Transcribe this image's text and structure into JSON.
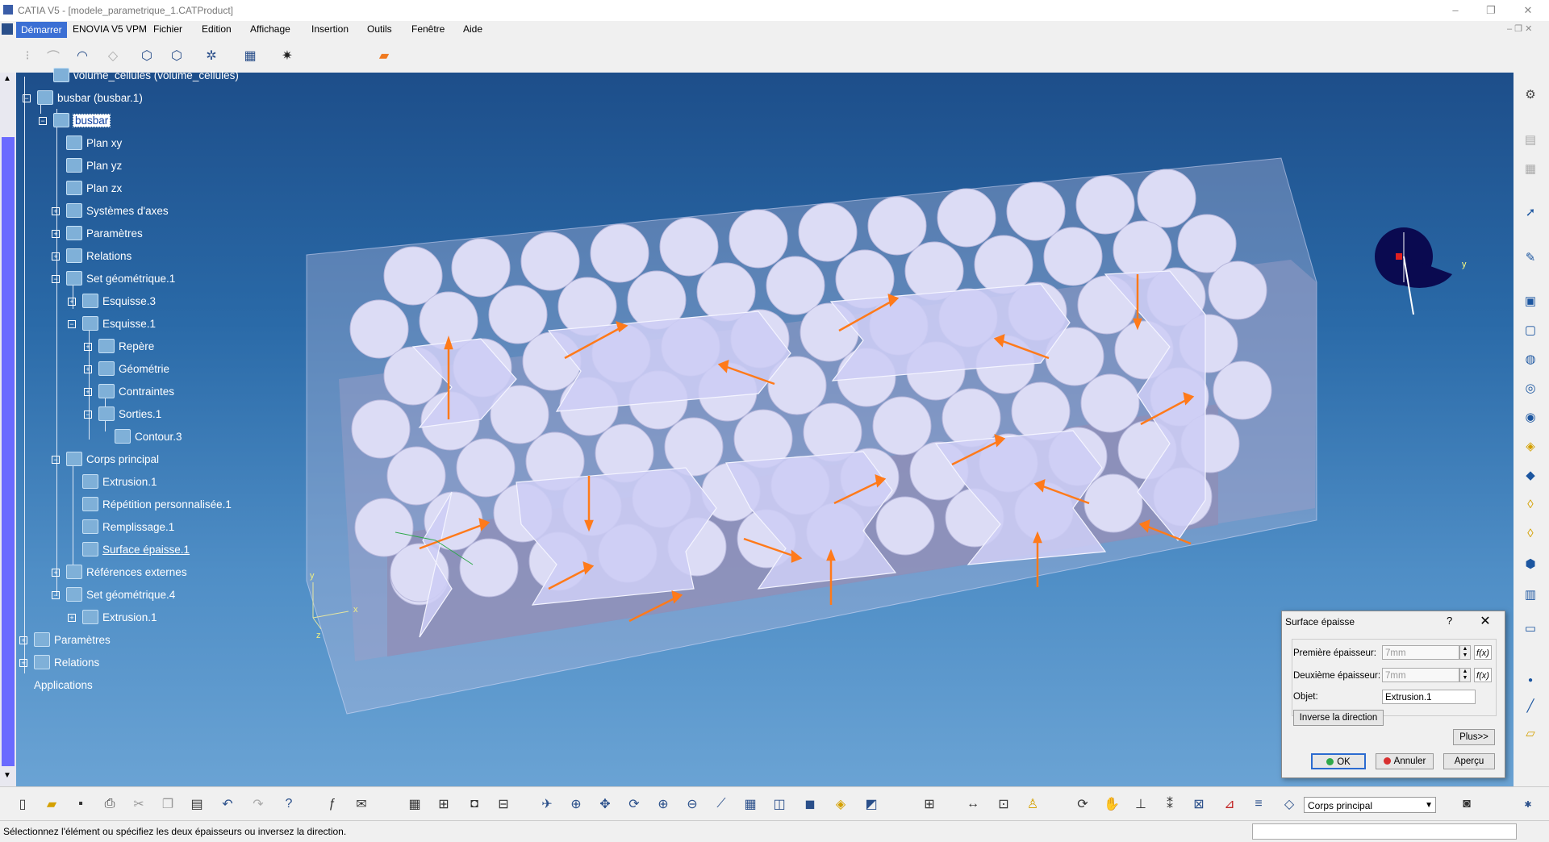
{
  "window": {
    "title": "CATIA V5 - [modele_parametrique_1.CATProduct]",
    "controls": [
      "–",
      "❐",
      "✕"
    ]
  },
  "menubar": {
    "start": "Démarrer",
    "items": [
      "ENOVIA V5 VPM",
      "Fichier",
      "Edition",
      "Affichage",
      "Insertion",
      "Outils",
      "Fenêtre",
      "Aide"
    ]
  },
  "tree": {
    "nodes": [
      {
        "label": "volume_cellules (volume_cellules)"
      },
      {
        "label": "busbar (busbar.1)"
      },
      {
        "label": "busbar",
        "selected": true
      },
      {
        "label": "Plan xy"
      },
      {
        "label": "Plan yz"
      },
      {
        "label": "Plan zx"
      },
      {
        "label": "Systèmes d'axes"
      },
      {
        "label": "Paramètres"
      },
      {
        "label": "Relations"
      },
      {
        "label": "Set géométrique.1"
      },
      {
        "label": "Esquisse.3"
      },
      {
        "label": "Esquisse.1"
      },
      {
        "label": "Repère"
      },
      {
        "label": "Géométrie"
      },
      {
        "label": "Contraintes"
      },
      {
        "label": "Sorties.1"
      },
      {
        "label": "Contour.3"
      },
      {
        "label": "Corps principal"
      },
      {
        "label": "Extrusion.1"
      },
      {
        "label": "Répétition personnalisée.1"
      },
      {
        "label": "Remplissage.1"
      },
      {
        "label": "Surface épaisse.1",
        "underline": true
      },
      {
        "label": "Références externes"
      },
      {
        "label": "Set géométrique.4"
      },
      {
        "label": "Extrusion.1"
      },
      {
        "label": "Paramètres"
      },
      {
        "label": "Relations"
      },
      {
        "label": "Applications"
      }
    ]
  },
  "viewport": {
    "compass_axis_y": "y",
    "axis_labels": {
      "x": "x",
      "y": "y",
      "z": "z"
    }
  },
  "dialog": {
    "title": "Surface épaisse",
    "help": "?",
    "close": "✕",
    "first_thickness_label": "Première épaisseur:",
    "first_thickness_value": "7mm",
    "second_thickness_label": "Deuxième épaisseur:",
    "second_thickness_value": "7mm",
    "object_label": "Objet:",
    "object_value": "Extrusion.1",
    "fx": "f(x)",
    "reverse_label": "Inverse la direction",
    "more_label": "Plus>>",
    "ok_label": "OK",
    "cancel_label": "Annuler",
    "preview_label": "Aperçu"
  },
  "body_dropdown": {
    "value": "Corps principal"
  },
  "status": {
    "message": "Sélectionnez l'élément ou spécifiez les deux épaisseurs ou inversez la direction."
  },
  "colors": {
    "viewport_top": "#1d4e8a",
    "viewport_bottom": "#6aa3d4",
    "selection": "#3b6fd4",
    "arrow": "#ff7a1a",
    "cell": "#d8d8f2"
  }
}
